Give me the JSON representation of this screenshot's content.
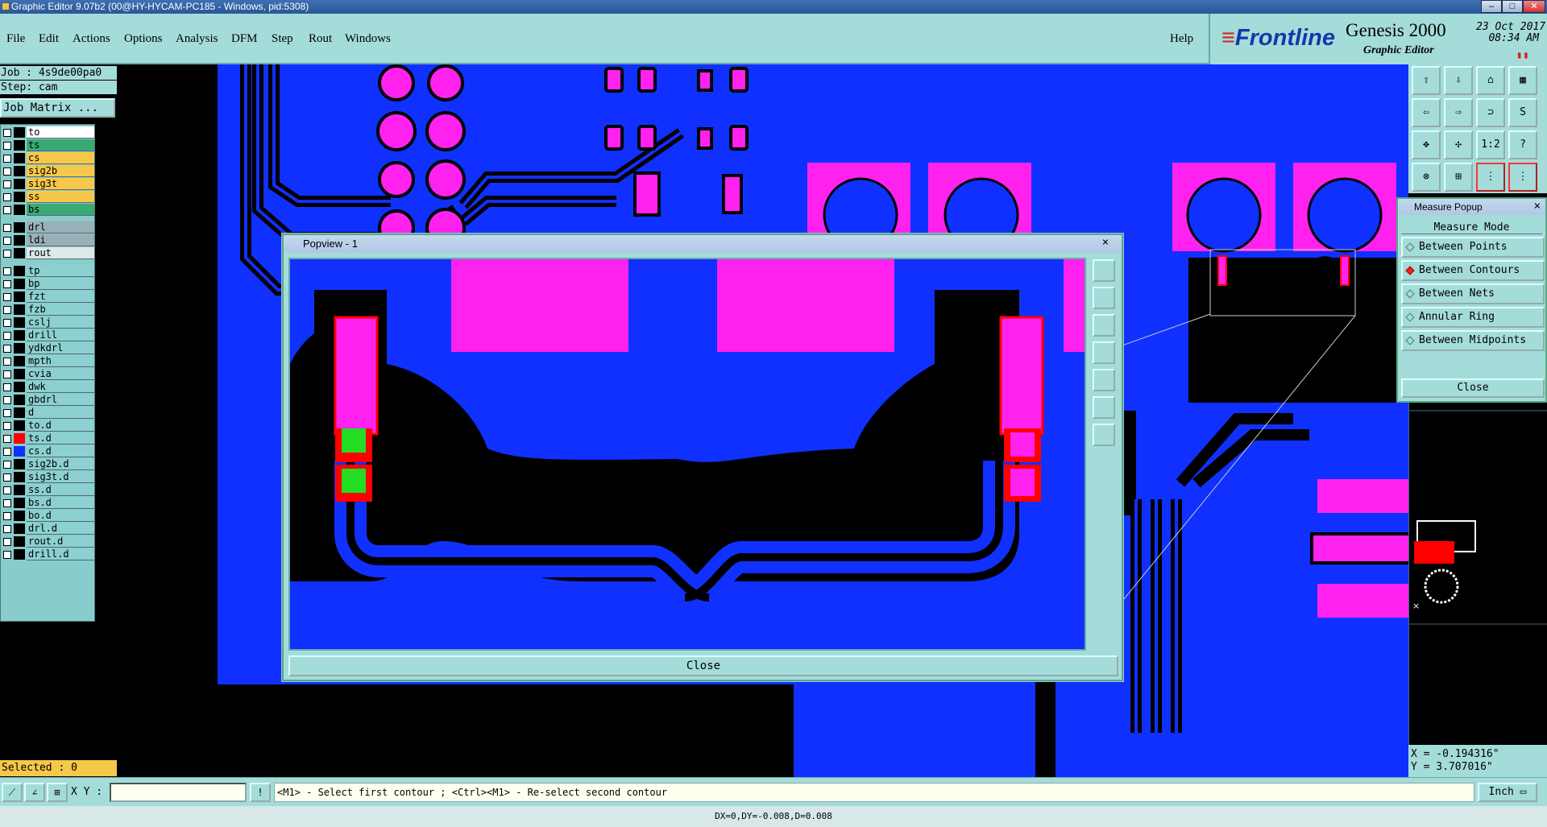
{
  "window": {
    "title": "Graphic Editor 9.07b2 (00@HY-HYCAM-PC185 - Windows, pid:5308)"
  },
  "menu": {
    "items": [
      "File",
      "Edit",
      "Actions",
      "Options",
      "Analysis",
      "DFM",
      "Step",
      "Rout",
      "Windows"
    ],
    "help": "Help"
  },
  "brand": {
    "logo": "Frontline",
    "product": "Genesis 2000",
    "subtitle": "Graphic Editor",
    "date": "23 Oct 2017",
    "time": "08:34 AM"
  },
  "job": {
    "job_line": "Job : 4s9de00pa0",
    "step_line": "Step: cam",
    "matrix_button": "Job Matrix ..."
  },
  "layers": [
    {
      "name": "to",
      "color": "#ffffff",
      "swatch": "#000000"
    },
    {
      "name": "ts",
      "color": "#3aaa74",
      "swatch": "#000000"
    },
    {
      "name": "cs",
      "color": "#f6c84a",
      "swatch": "#000000"
    },
    {
      "name": "sig2b",
      "color": "#f6c84a",
      "swatch": "#000000"
    },
    {
      "name": "sig3t",
      "color": "#f6c84a",
      "swatch": "#000000"
    },
    {
      "name": "ss",
      "color": "#f6c84a",
      "swatch": "#000000"
    },
    {
      "name": "bs",
      "color": "#3aaa74",
      "swatch": "#000000"
    },
    {
      "name": "drl",
      "color": "#9ab0b8",
      "swatch": "#000000"
    },
    {
      "name": "ldi",
      "color": "#9ab0b8",
      "swatch": "#000000"
    },
    {
      "name": "rout",
      "color": "#dde8e8",
      "swatch": "#000000"
    },
    {
      "name": "tp",
      "color": "#8cd0d0",
      "swatch": "#000000"
    },
    {
      "name": "bp",
      "color": "#8cd0d0",
      "swatch": "#000000"
    },
    {
      "name": "fzt",
      "color": "#8cd0d0",
      "swatch": "#000000"
    },
    {
      "name": "fzb",
      "color": "#8cd0d0",
      "swatch": "#000000"
    },
    {
      "name": "cslj",
      "color": "#8cd0d0",
      "swatch": "#000000"
    },
    {
      "name": "drill",
      "color": "#8cd0d0",
      "swatch": "#000000"
    },
    {
      "name": "ydkdrl",
      "color": "#8cd0d0",
      "swatch": "#000000"
    },
    {
      "name": "mpth",
      "color": "#8cd0d0",
      "swatch": "#000000"
    },
    {
      "name": "cvia",
      "color": "#8cd0d0",
      "swatch": "#000000"
    },
    {
      "name": "dwk",
      "color": "#8cd0d0",
      "swatch": "#000000"
    },
    {
      "name": "gbdrl",
      "color": "#8cd0d0",
      "swatch": "#000000"
    },
    {
      "name": "d",
      "color": "#8cd0d0",
      "swatch": "#000000"
    },
    {
      "name": "to.d",
      "color": "#8cd0d0",
      "swatch": "#000000"
    },
    {
      "name": "ts.d",
      "color": "#8cd0d0",
      "swatch": "#ff0000"
    },
    {
      "name": "cs.d",
      "color": "#8cd0d0",
      "swatch": "#1030ff"
    },
    {
      "name": "sig2b.d",
      "color": "#8cd0d0",
      "swatch": "#000000"
    },
    {
      "name": "sig3t.d",
      "color": "#8cd0d0",
      "swatch": "#000000"
    },
    {
      "name": "ss.d",
      "color": "#8cd0d0",
      "swatch": "#000000"
    },
    {
      "name": "bs.d",
      "color": "#8cd0d0",
      "swatch": "#000000"
    },
    {
      "name": "bo.d",
      "color": "#8cd0d0",
      "swatch": "#000000"
    },
    {
      "name": "drl.d",
      "color": "#8cd0d0",
      "swatch": "#000000"
    },
    {
      "name": "rout.d",
      "color": "#8cd0d0",
      "swatch": "#000000"
    },
    {
      "name": "drill.d",
      "color": "#8cd0d0",
      "swatch": "#000000"
    }
  ],
  "selected": "Selected : 0",
  "popview": {
    "title": "Popview - 1",
    "close": "Close",
    "close_x": "×"
  },
  "measure": {
    "title": "Measure Popup",
    "header": "Measure Mode",
    "options": [
      "Between Points",
      "Between Contours",
      "Between Nets",
      "Annular Ring",
      "Between Midpoints"
    ],
    "active": "Between Contours",
    "close": "Close",
    "close_x": "×"
  },
  "toolbox": {
    "ratio_label": "1:2",
    "help_label": "?"
  },
  "coords": {
    "x": "X = -0.194316\"",
    "y": "Y =  3.707016\""
  },
  "command": {
    "xy_label": "X Y :",
    "xy_value": "",
    "prompt": "<M1> - Select first contour ; <Ctrl><M1> - Re-select second contour",
    "units": "Inch"
  },
  "status": {
    "text": "DX=0,DY=-0.008,D=0.008"
  },
  "colors": {
    "panel": "#a4dcda",
    "copper": "#1030ff",
    "pad": "#ff22ee",
    "highlight": "#ff0000",
    "select": "#22dd22"
  }
}
